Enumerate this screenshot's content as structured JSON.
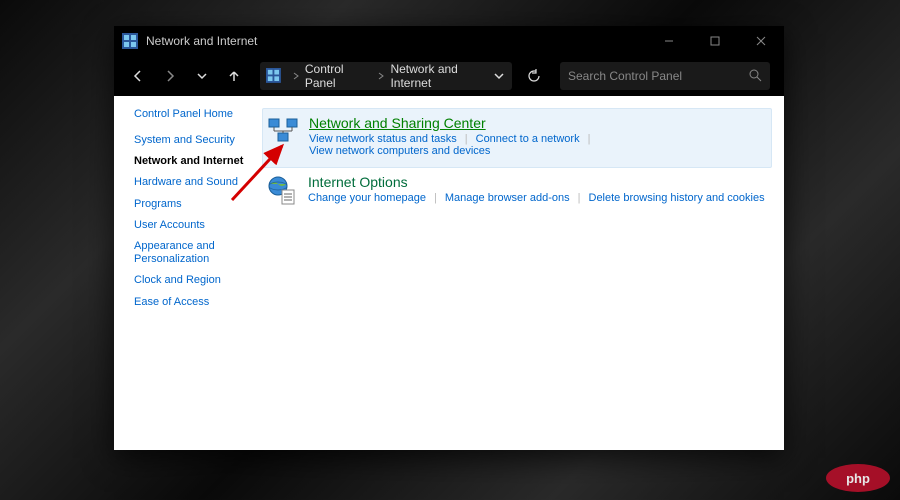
{
  "window": {
    "title": "Network and Internet"
  },
  "toolbar": {
    "breadcrumb": [
      "Control Panel",
      "Network and Internet"
    ],
    "search_placeholder": "Search Control Panel"
  },
  "sidebar": {
    "home": "Control Panel Home",
    "items": [
      {
        "label": "System and Security",
        "active": false
      },
      {
        "label": "Network and Internet",
        "active": true
      },
      {
        "label": "Hardware and Sound",
        "active": false
      },
      {
        "label": "Programs",
        "active": false
      },
      {
        "label": "User Accounts",
        "active": false
      },
      {
        "label": "Appearance and Personalization",
        "active": false
      },
      {
        "label": "Clock and Region",
        "active": false
      },
      {
        "label": "Ease of Access",
        "active": false
      }
    ]
  },
  "content": {
    "sections": [
      {
        "title": "Network and Sharing Center",
        "highlight": true,
        "icon": "network-sharing-icon",
        "sublinks": [
          "View network status and tasks",
          "Connect to a network",
          "View network computers and devices"
        ]
      },
      {
        "title": "Internet Options",
        "highlight": false,
        "icon": "internet-options-icon",
        "sublinks": [
          "Change your homepage",
          "Manage browser add-ons",
          "Delete browsing history and cookies"
        ]
      }
    ]
  },
  "watermark": "php"
}
